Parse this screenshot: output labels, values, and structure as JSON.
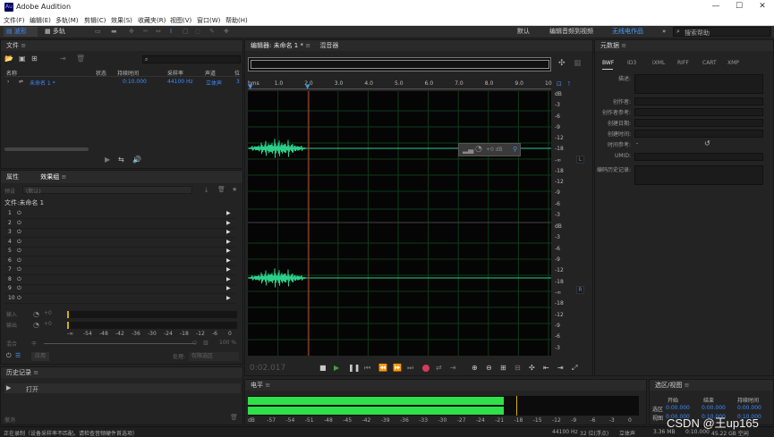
{
  "app": {
    "title": "Adobe Audition",
    "logo": "Au"
  },
  "menu": [
    "文件(F)",
    "编辑(E)",
    "多轨(M)",
    "剪辑(C)",
    "效果(S)",
    "收藏夹(R)",
    "视图(V)",
    "窗口(W)",
    "帮助(H)"
  ],
  "toolbar": {
    "waveform": "波形",
    "multitrack": "多轨",
    "workspace_default": "默认",
    "workspace_edit": "编辑音频到视频",
    "workspace_active": "无线电作品",
    "search_placeholder": "搜索帮助"
  },
  "files": {
    "tab": "文件",
    "cols": [
      "名称",
      "状态",
      "持续时间",
      "采样率",
      "声道",
      "位"
    ],
    "row": {
      "name": "未命名 1 *",
      "duration": "0:10.000",
      "rate": "44100 Hz",
      "channels": "立体声",
      "bits": "3"
    }
  },
  "effects": {
    "tab_props": "属性",
    "tab_rack": "效果组",
    "preset_label": "预设",
    "preset_value": "(默认)",
    "file_label": "文件:未命名 1",
    "slots": [
      "1",
      "2",
      "3",
      "4",
      "5",
      "6",
      "7",
      "8",
      "9",
      "10"
    ],
    "input_label": "输入",
    "output_label": "输出",
    "gain": "+0",
    "mix_label": "混合",
    "mix_value": "100 %",
    "process_label": "处理:",
    "process_value": "仅限选区",
    "apply": "应用",
    "meter": [
      "-∞",
      "-54",
      "-48",
      "-42",
      "-36",
      "-30",
      "-24",
      "-18",
      "-12",
      "-6",
      "0"
    ]
  },
  "history": {
    "tab": "历史记录",
    "item": "打开",
    "undo": "撤消"
  },
  "editor": {
    "tab": "编辑器: 未命名 1 *",
    "mixer": "混音器",
    "ruler": [
      "hms",
      "1.0",
      "2.0",
      "3.0",
      "4.0",
      "5.0",
      "6.0",
      "7.0",
      "8.0",
      "9.0",
      "10"
    ],
    "db_top": [
      "dB",
      "-3",
      "-6",
      "-9",
      "-12",
      "-18",
      "-∞",
      "-18",
      "-12",
      "-9",
      "-6",
      "-3"
    ],
    "db_bottom": [
      "dB",
      "-3",
      "-6",
      "-9",
      "-12",
      "-18",
      "-∞",
      "-18",
      "-12",
      "-9",
      "-6",
      "-3"
    ],
    "hud_gain": "+0 dB",
    "ch_left": "L",
    "ch_right": "R",
    "time": "0:02.017"
  },
  "levels": {
    "tab": "电平",
    "scale": [
      "dB",
      "-57",
      "-54",
      "-51",
      "-48",
      "-45",
      "-42",
      "-39",
      "-36",
      "-33",
      "-30",
      "-27",
      "-24",
      "-21",
      "-18",
      "-15",
      "-12",
      "-9",
      "-6",
      "-3",
      "0"
    ],
    "fill": 0.655
  },
  "meta": {
    "tab": "元数据",
    "tabs": [
      "BWF",
      "ID3",
      "iXML",
      "RIFF",
      "CART",
      "XMP"
    ],
    "fields": [
      "描述:",
      "创作者:",
      "创作者参考:",
      "创建日期:",
      "创建时间:",
      "时间参考:",
      "UMID:",
      "编码历史记录:"
    ],
    "time_ref": "-"
  },
  "selection": {
    "tab": "选区/视图",
    "cols": [
      "开始",
      "结束",
      "持续时间"
    ],
    "rows": [
      {
        "label": "选区",
        "start": "0:00.000",
        "end": "0:00.000",
        "dur": "0:00.000"
      },
      {
        "label": "视图",
        "start": "0:00.000",
        "end": "0:10.000",
        "dur": "0:10.000"
      }
    ]
  },
  "status": {
    "left": "正在录制（设备采样率不匹配。请检查音频硬件首选项）",
    "rate": "44100 Hz",
    "bits": "32 位(浮点)",
    "ch": "立体声",
    "size": "3.36 MB",
    "dur": "0:10.000",
    "free": "45.22 GB 空闲",
    "watermark": "CSDN @王up165"
  }
}
